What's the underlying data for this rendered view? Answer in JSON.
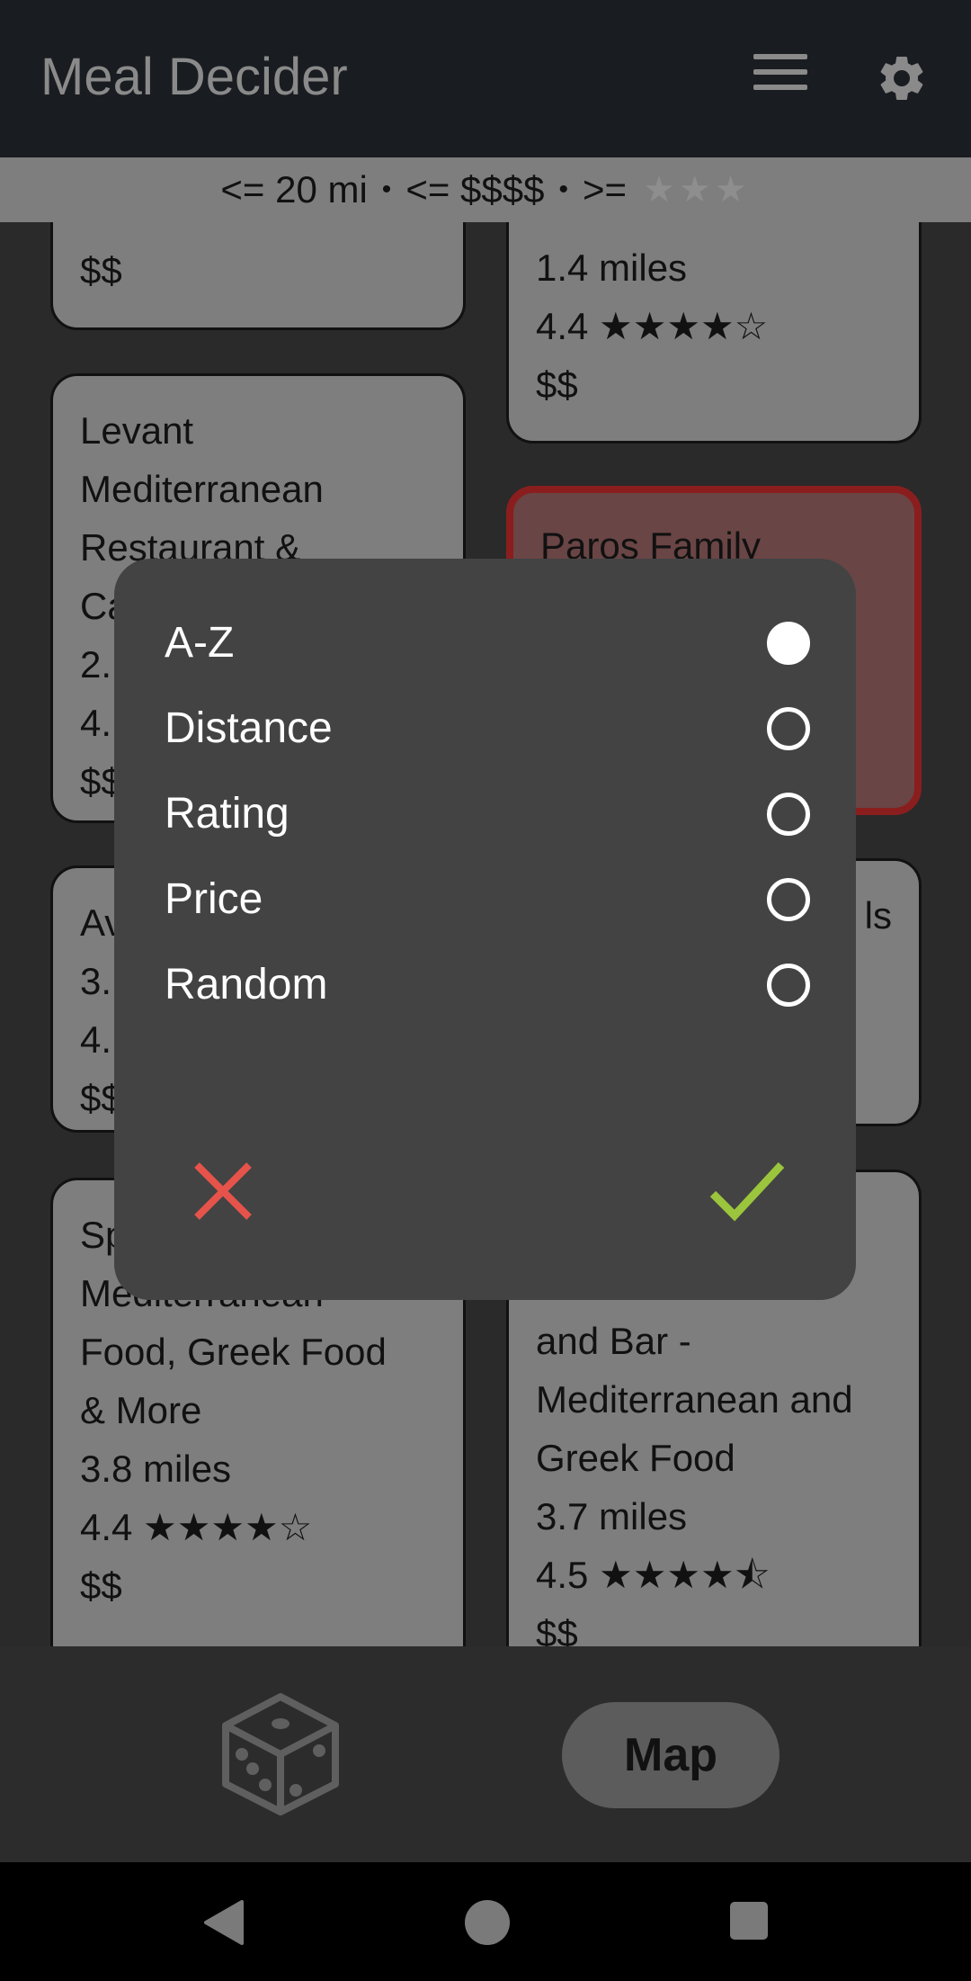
{
  "app": {
    "title": "Meal Decider"
  },
  "filter": {
    "distance": "<= 20 mi",
    "separator": "•",
    "price": "<= $$$$",
    "rating_prefix": ">=",
    "rating_stars": "★★★"
  },
  "cards": [
    {
      "lines": [
        "$$"
      ]
    },
    {
      "lines": [
        "1.4 miles",
        "4.4 ★★★★☆",
        "$$"
      ]
    },
    {
      "lines": [
        "Levant",
        "Mediterranean",
        "Restaurant &",
        "Ca",
        "2.",
        "4.",
        "$$"
      ]
    },
    {
      "lines": [
        "Paros Family"
      ]
    },
    {
      "lines": [
        "Av",
        "3.",
        "4.",
        "$$"
      ]
    },
    {
      "lines": [
        "ls"
      ]
    },
    {
      "lines": [
        "Sp",
        "Mediterranean",
        "Food, Greek Food",
        "& More",
        "3.8 miles",
        "4.4 ★★★★☆",
        "$$"
      ]
    },
    {
      "lines": [
        "and Bar -",
        "Mediterranean and",
        "Greek Food",
        "3.7 miles",
        "4.5 ★★★★⯪",
        "$$"
      ]
    }
  ],
  "sort_dialog": {
    "options": [
      {
        "label": "A-Z",
        "selected": true
      },
      {
        "label": "Distance",
        "selected": false
      },
      {
        "label": "Rating",
        "selected": false
      },
      {
        "label": "Price",
        "selected": false
      },
      {
        "label": "Random",
        "selected": false
      }
    ],
    "cancel_color": "#e5534b",
    "confirm_color": "#9bc53d"
  },
  "bottom": {
    "map_label": "Map"
  },
  "colors": {
    "selected_border": "#8a1e1e",
    "accent_check": "#9bc53d",
    "cancel_x": "#e5534b"
  }
}
